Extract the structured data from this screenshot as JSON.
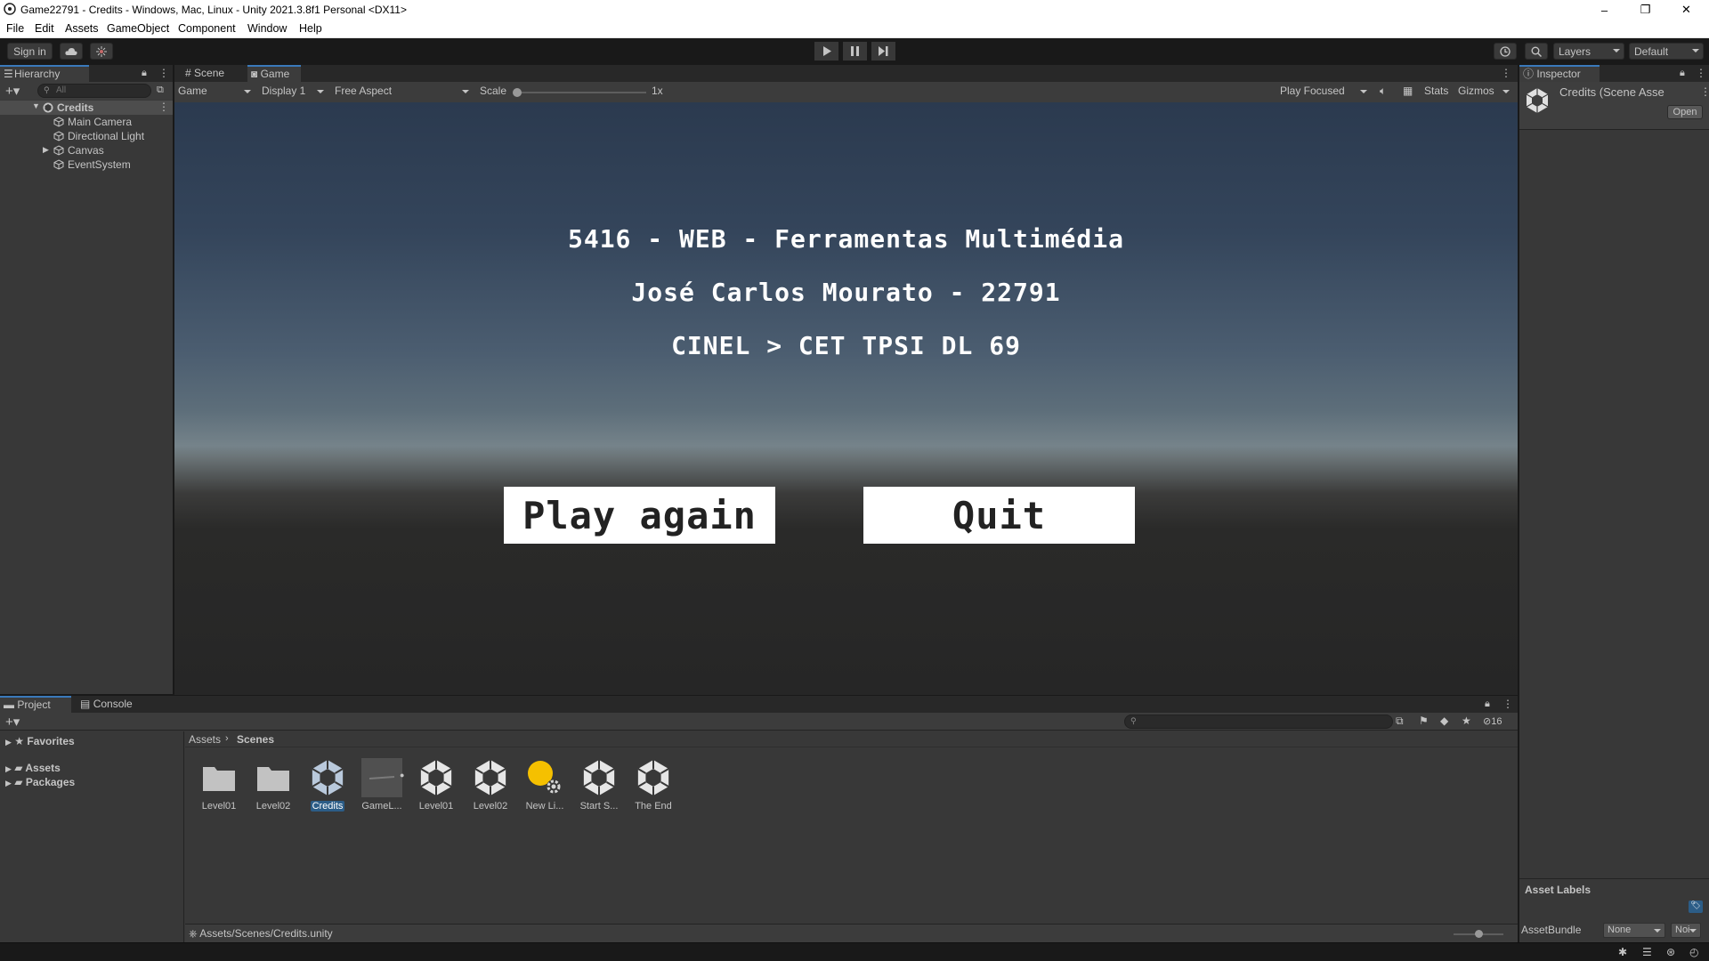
{
  "window": {
    "title": "Game22791 - Credits - Windows, Mac, Linux - Unity 2021.3.8f1 Personal <DX11>",
    "minimize": "–",
    "maximize": "❐",
    "close": "✕"
  },
  "menu": [
    "File",
    "Edit",
    "Assets",
    "GameObject",
    "Component",
    "Window",
    "Help"
  ],
  "toolbar": {
    "sign_in": "Sign in",
    "layers": "Layers",
    "layout": "Default"
  },
  "hierarchy": {
    "tab": "Hierarchy",
    "search_placeholder": "All",
    "scene": "Credits",
    "items": [
      "Main Camera",
      "Directional Light",
      "Canvas",
      "EventSystem"
    ]
  },
  "center_tabs": [
    "Scene",
    "Game"
  ],
  "game_toolbar": {
    "mode": "Game",
    "display": "Display 1",
    "aspect": "Free Aspect",
    "scale_label": "Scale",
    "scale_value": "1x",
    "play_mode": "Play Focused",
    "stats": "Stats",
    "gizmos": "Gizmos"
  },
  "game": {
    "line1": "5416 - WEB - Ferramentas Multimédia",
    "line2": "José Carlos Mourato - 22791",
    "line3": "CINEL > CET TPSI DL 69",
    "play_again": "Play again",
    "quit": "Quit"
  },
  "inspector": {
    "tab": "Inspector",
    "asset_title": "Credits (Scene Asse",
    "open": "Open",
    "asset_labels": "Asset Labels",
    "asset_bundle_label": "AssetBundle",
    "asset_bundle_value": "None",
    "asset_variant_value": "Noi"
  },
  "project": {
    "tabs": [
      "Project",
      "Console"
    ],
    "tree": [
      "Favorites",
      "Assets",
      "Packages"
    ],
    "breadcrumb": [
      "Assets",
      "Scenes"
    ],
    "hidden_count": "16",
    "assets": [
      {
        "label": "Level01",
        "kind": "folder"
      },
      {
        "label": "Level02",
        "kind": "folder"
      },
      {
        "label": "Credits",
        "kind": "scene"
      },
      {
        "label": "GameL...",
        "kind": "prefab"
      },
      {
        "label": "Level01",
        "kind": "scene"
      },
      {
        "label": "Level02",
        "kind": "scene"
      },
      {
        "label": "New Li...",
        "kind": "lighting"
      },
      {
        "label": "Start S...",
        "kind": "scene"
      },
      {
        "label": "The End",
        "kind": "scene"
      }
    ],
    "footer_path": "Assets/Scenes/Credits.unity"
  },
  "colors": {
    "accent": "#3a79bb",
    "selection": "#2c5d87",
    "panel": "#383838",
    "panel_dark": "#282828"
  }
}
